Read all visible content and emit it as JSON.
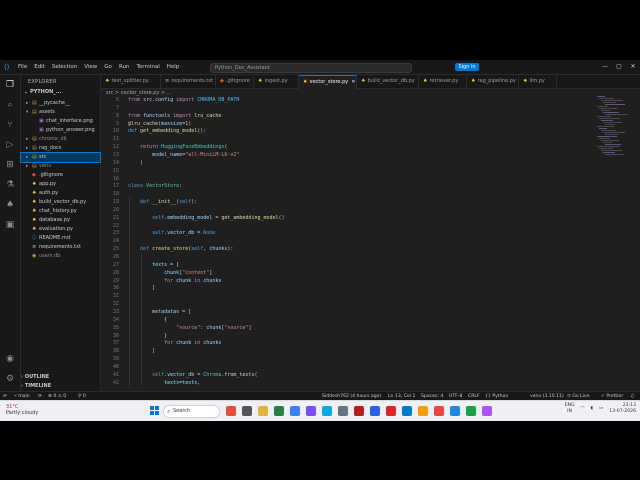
{
  "titlebar": {
    "menu": [
      "File",
      "Edit",
      "Selection",
      "View",
      "Go",
      "Run",
      "Terminal",
      "Help"
    ],
    "command_center": "Python_Doc_Assistant",
    "sign_in": "Sign in",
    "window_controls": [
      "—",
      "▢",
      "✕"
    ]
  },
  "sidebar": {
    "header": "EXPLORER",
    "root": "PYTHON_...",
    "items": [
      {
        "label": "__pycache__",
        "kind": "folder",
        "depth": 1,
        "dim": false
      },
      {
        "label": "assets",
        "kind": "folder-open",
        "depth": 1,
        "dim": false
      },
      {
        "label": "chat_interface.png",
        "kind": "image",
        "depth": 2,
        "dim": false
      },
      {
        "label": "python_answer.png",
        "kind": "image",
        "depth": 2,
        "dim": false
      },
      {
        "label": "chroma_db",
        "kind": "folder",
        "depth": 1,
        "dim": true
      },
      {
        "label": "rag_docs",
        "kind": "folder",
        "depth": 1,
        "dim": false
      },
      {
        "label": "src",
        "kind": "folder",
        "depth": 1,
        "dim": false,
        "selected": true
      },
      {
        "label": "venv",
        "kind": "folder",
        "depth": 1,
        "dim": true
      },
      {
        "label": ".gitignore",
        "kind": "git",
        "depth": 1,
        "dim": false
      },
      {
        "label": "app.py",
        "kind": "py",
        "depth": 1,
        "dim": false
      },
      {
        "label": "auth.py",
        "kind": "py",
        "depth": 1,
        "dim": false
      },
      {
        "label": "build_vector_db.py",
        "kind": "py",
        "depth": 1,
        "dim": false
      },
      {
        "label": "chat_history.py",
        "kind": "py",
        "depth": 1,
        "dim": false
      },
      {
        "label": "database.py",
        "kind": "py",
        "depth": 1,
        "dim": false
      },
      {
        "label": "evaluation.py",
        "kind": "py",
        "depth": 1,
        "dim": false
      },
      {
        "label": "README.md",
        "kind": "md",
        "depth": 1,
        "dim": false
      },
      {
        "label": "requirements.txt",
        "kind": "txt",
        "depth": 1,
        "dim": false
      },
      {
        "label": "users.db",
        "kind": "db",
        "depth": 1,
        "dim": true
      }
    ],
    "outline": "OUTLINE",
    "timeline": "TIMELINE"
  },
  "tabs": [
    {
      "label": "text_splitter.py",
      "active": false
    },
    {
      "label": "requirements.txt",
      "active": false
    },
    {
      "label": ".gitignore",
      "active": false
    },
    {
      "label": "ingest.py",
      "active": false
    },
    {
      "label": "vector_store.py",
      "active": true
    },
    {
      "label": "build_vector_db.py",
      "active": false
    },
    {
      "label": "retriever.py",
      "active": false
    },
    {
      "label": "rag_pipeline.py",
      "active": false
    },
    {
      "label": "llm.py",
      "active": false
    }
  ],
  "breadcrumb": "src > vector_store.py > ...",
  "editor": {
    "lines": [
      {
        "n": "6",
        "code": "from src.config import CHROMA_DB_PATH"
      },
      {
        "n": "7",
        "code": ""
      },
      {
        "n": "8",
        "code": "from functools import lru_cache"
      },
      {
        "n": "9",
        "code": "@lru_cache(maxsize=1)"
      },
      {
        "n": "10",
        "code": "def get_embedding_model():"
      },
      {
        "n": "11",
        "code": ""
      },
      {
        "n": "12",
        "code": "    return HuggingFaceEmbeddings("
      },
      {
        "n": "13",
        "code": "        model_name=\"all-MiniLM-L6-v2\""
      },
      {
        "n": "14",
        "code": "    )"
      },
      {
        "n": "15",
        "code": ""
      },
      {
        "n": "16",
        "code": ""
      },
      {
        "n": "17",
        "code": "class VectorStore:"
      },
      {
        "n": "18",
        "code": ""
      },
      {
        "n": "19",
        "code": "    def __init__(self):"
      },
      {
        "n": "20",
        "code": ""
      },
      {
        "n": "21",
        "code": "        self.embedding_model = get_embedding_model()"
      },
      {
        "n": "22",
        "code": ""
      },
      {
        "n": "23",
        "code": "        self.vector_db = None"
      },
      {
        "n": "24",
        "code": ""
      },
      {
        "n": "25",
        "code": "    def create_store(self, chunks):"
      },
      {
        "n": "26",
        "code": ""
      },
      {
        "n": "27",
        "code": "        texts = ["
      },
      {
        "n": "28",
        "code": "            chunk[\"content\"]"
      },
      {
        "n": "29",
        "code": "            for chunk in chunks"
      },
      {
        "n": "30",
        "code": "        ]"
      },
      {
        "n": "31",
        "code": ""
      },
      {
        "n": "32",
        "code": ""
      },
      {
        "n": "33",
        "code": "        metadatas = ["
      },
      {
        "n": "34",
        "code": "            {"
      },
      {
        "n": "35",
        "code": "                \"source\": chunk[\"source\"]"
      },
      {
        "n": "36",
        "code": "            }"
      },
      {
        "n": "37",
        "code": "            for chunk in chunks"
      },
      {
        "n": "38",
        "code": "        ]"
      },
      {
        "n": "39",
        "code": ""
      },
      {
        "n": "40",
        "code": ""
      },
      {
        "n": "41",
        "code": "        self.vector_db = Chroma.from_texts("
      },
      {
        "n": "42",
        "code": "            texts=texts,"
      }
    ]
  },
  "statusbar": {
    "branch": "main",
    "errors": "0",
    "warnings": "0",
    "sync": "0",
    "git_info": "Siddesh762 (4 hours ago)",
    "position": "Ln 13, Col 1",
    "spaces": "Spaces: 4",
    "encoding": "UTF-8",
    "eol": "CRLF",
    "language": "Python",
    "interpreter": "venv (3.10.11)",
    "golive": "Go Live",
    "prettier": "Prettier"
  },
  "taskbar": {
    "temp": "31°C",
    "weather": "Partly cloudy",
    "search": "Search",
    "lang": "ENG",
    "region": "IN",
    "time": "23:13",
    "date": "13-07-2026"
  }
}
